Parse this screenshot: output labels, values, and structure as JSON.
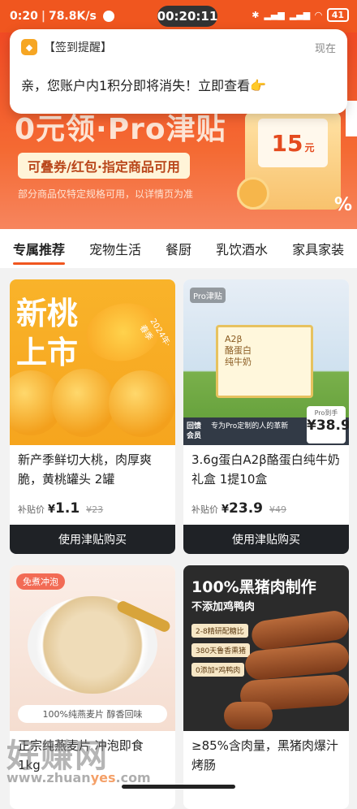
{
  "status_bar": {
    "time": "0:20",
    "speed": "78.8K/s",
    "clock": "00:20:11",
    "battery": "41"
  },
  "notification": {
    "title": "【签到提醒】",
    "time": "现在",
    "body": "亲，您账户内1积分即将消失！立即查看👉"
  },
  "banner": {
    "headline": "0元领·Pro津贴",
    "pill": "可叠券/红包·指定商品可用",
    "note": "部分商品仅特定规格可用，以详情页为准",
    "envelope_amount": "15",
    "envelope_unit": "元",
    "percent_mark": "%"
  },
  "tabs": [
    "专属推荐",
    "宠物生活",
    "餐厨",
    "乳饮酒水",
    "家具家装"
  ],
  "products": [
    {
      "image_text": "新桃\n上市",
      "image_side": "2024年·春季",
      "title": "新产季鲜切大桃，肉厚爽脆，黄桃罐头 2罐",
      "price_label": "补贴价",
      "price": "1.1",
      "old_price": "¥23",
      "button": "使用津贴购买"
    },
    {
      "image_pro": "Pro津贴",
      "image_box": "A2β\n酪蛋白\n纯牛奶",
      "image_tag": "回馈\n会员",
      "image_desc": "专为Pro定制的人的革新",
      "image_price_label": "Pro到手",
      "image_price": "¥38.9",
      "title": "3.6g蛋白A2β酪蛋白纯牛奶礼盒 1提10盒",
      "price_label": "补贴价",
      "price": "23.9",
      "old_price": "¥49",
      "button": "使用津贴购买"
    },
    {
      "image_tag": "免煮冲泡",
      "image_strip": "100%纯燕麦片  醇香回味",
      "title": "正宗纯燕麦片 冲泡即食 1kg",
      "button": ""
    },
    {
      "image_h1": "100%黑猪肉制作",
      "image_h2": "不添加鸡鸭肉",
      "image_chips": [
        "2-8精研配糖比",
        "380天鲁香熏猪",
        "0添加*鸡鸭肉"
      ],
      "title": "≥85%含肉量，黑猪肉爆汁烤肠",
      "button": ""
    }
  ],
  "watermark": {
    "main": "好赚网",
    "url_prefix": "www.zhuan",
    "url_highlight": "yes",
    "url_suffix": ".com"
  }
}
